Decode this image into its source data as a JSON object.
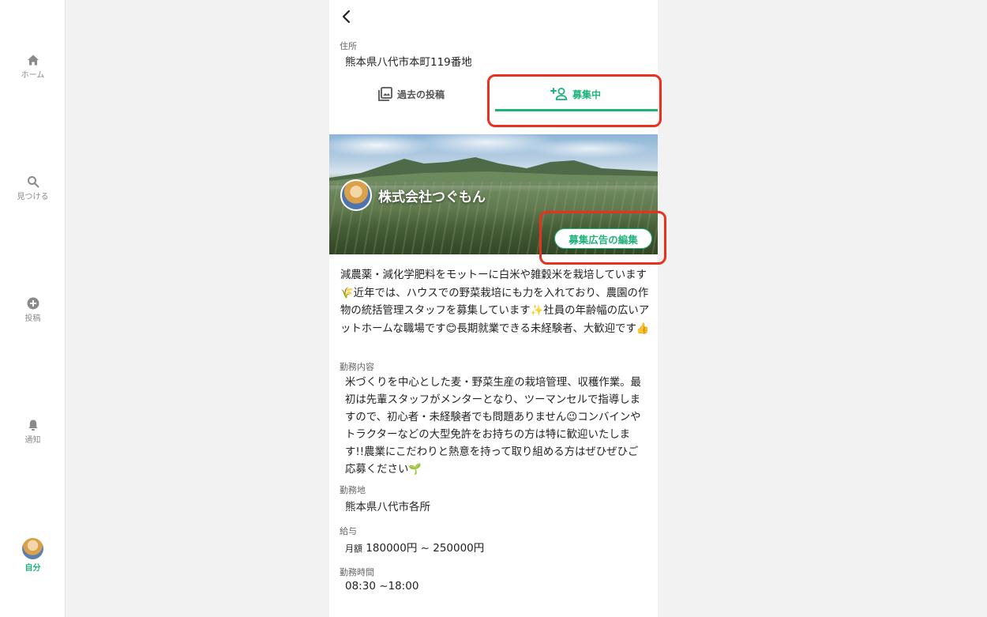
{
  "nav": {
    "items": [
      {
        "label": "ホーム"
      },
      {
        "label": "見つける"
      },
      {
        "label": "投稿"
      },
      {
        "label": "通知"
      },
      {
        "label": "自分"
      }
    ]
  },
  "address": {
    "label": "住所",
    "value": "熊本県八代市本町119番地"
  },
  "tabs": {
    "past": "過去の投稿",
    "recruiting": "募集中"
  },
  "company": {
    "name": "株式会社つぐもん",
    "edit_button": "募集広告の編集"
  },
  "description": "減農薬・減化学肥料をモットーに白米や雑穀米を栽培しています🌾近年では、ハウスでの野菜栽培にも力を入れており、農園の作物の統括管理スタッフを募集しています✨社員の年齢幅の広いアットホームな職場です😊長期就業できる未経験者、大歓迎です👍",
  "job": {
    "duty_label": "勤務内容",
    "duty_value": "米づくりを中心とした麦・野菜生産の栽培管理、収穫作業。最初は先輩スタッフがメンターとなり、ツーマンセルで指導しますので、初心者・未経験者でも問題ありません😉コンバインやトラクターなどの大型免許をお持ちの方は特に歓迎いたします!!農業にこだわりと熱意を持って取り組める方はぜひぜひご応募ください🌱",
    "location_label": "勤務地",
    "location_value": "熊本県八代市各所",
    "salary_label": "給与",
    "salary_type": "月額",
    "salary_value": "180000円 ~ 250000円",
    "hours_label": "勤務時間",
    "hours_value": "08:30 ~18:00"
  },
  "colors": {
    "accent": "#1fb37a",
    "annotation": "#e8321e"
  }
}
